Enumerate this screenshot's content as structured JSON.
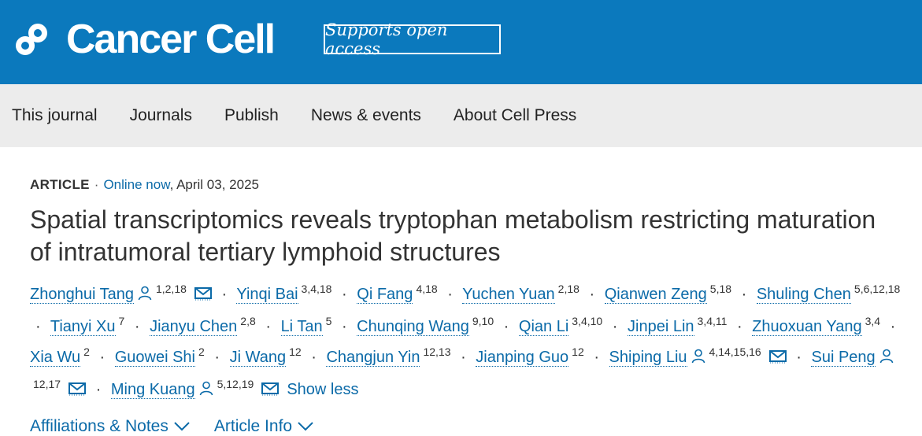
{
  "header": {
    "brand": "Cancer Cell",
    "badge": "Supports open access",
    "bg_color": "#0b79bd"
  },
  "nav": [
    "This journal",
    "Journals",
    "Publish",
    "News & events",
    "About Cell Press"
  ],
  "article": {
    "type": "ARTICLE",
    "online_label": "Online now",
    "date": ", April 03, 2025",
    "title": "Spatial transcriptomics reveals tryptophan metabolism restricting maturation of intratumoral tertiary lymphoid structures"
  },
  "authors": [
    {
      "name": "Zhonghui Tang",
      "sup": "1,2,18",
      "person": true,
      "mail": true
    },
    {
      "name": "Yinqi Bai",
      "sup": "3,4,18"
    },
    {
      "name": "Qi Fang",
      "sup": "4,18"
    },
    {
      "name": "Yuchen Yuan",
      "sup": "2,18"
    },
    {
      "name": "Qianwen Zeng",
      "sup": "5,18"
    },
    {
      "name": "Shuling Chen",
      "sup": "5,6,12,18"
    },
    {
      "name": "Tianyi Xu",
      "sup": "7"
    },
    {
      "name": "Jianyu Chen",
      "sup": "2,8"
    },
    {
      "name": "Li Tan",
      "sup": "5"
    },
    {
      "name": "Chunqing Wang",
      "sup": "9,10"
    },
    {
      "name": "Qian Li",
      "sup": "3,4,10"
    },
    {
      "name": "Jinpei Lin",
      "sup": "3,4,11"
    },
    {
      "name": "Zhuoxuan Yang",
      "sup": "3,4"
    },
    {
      "name": "Xia Wu",
      "sup": "2"
    },
    {
      "name": "Guowei Shi",
      "sup": "2"
    },
    {
      "name": "Ji Wang",
      "sup": "12"
    },
    {
      "name": "Changjun Yin",
      "sup": "12,13"
    },
    {
      "name": "Jianping Guo",
      "sup": "12"
    },
    {
      "name": "Shiping Liu",
      "sup": "4,14,15,16",
      "person": true,
      "mail": true
    },
    {
      "name": "Sui Peng",
      "sup": "12,17",
      "person": true,
      "mail": true
    },
    {
      "name": "Ming Kuang",
      "sup": "5,12,19",
      "person": true,
      "mail": true
    }
  ],
  "show_less": "Show less",
  "tabs": [
    "Affiliations & Notes",
    "Article Info"
  ]
}
